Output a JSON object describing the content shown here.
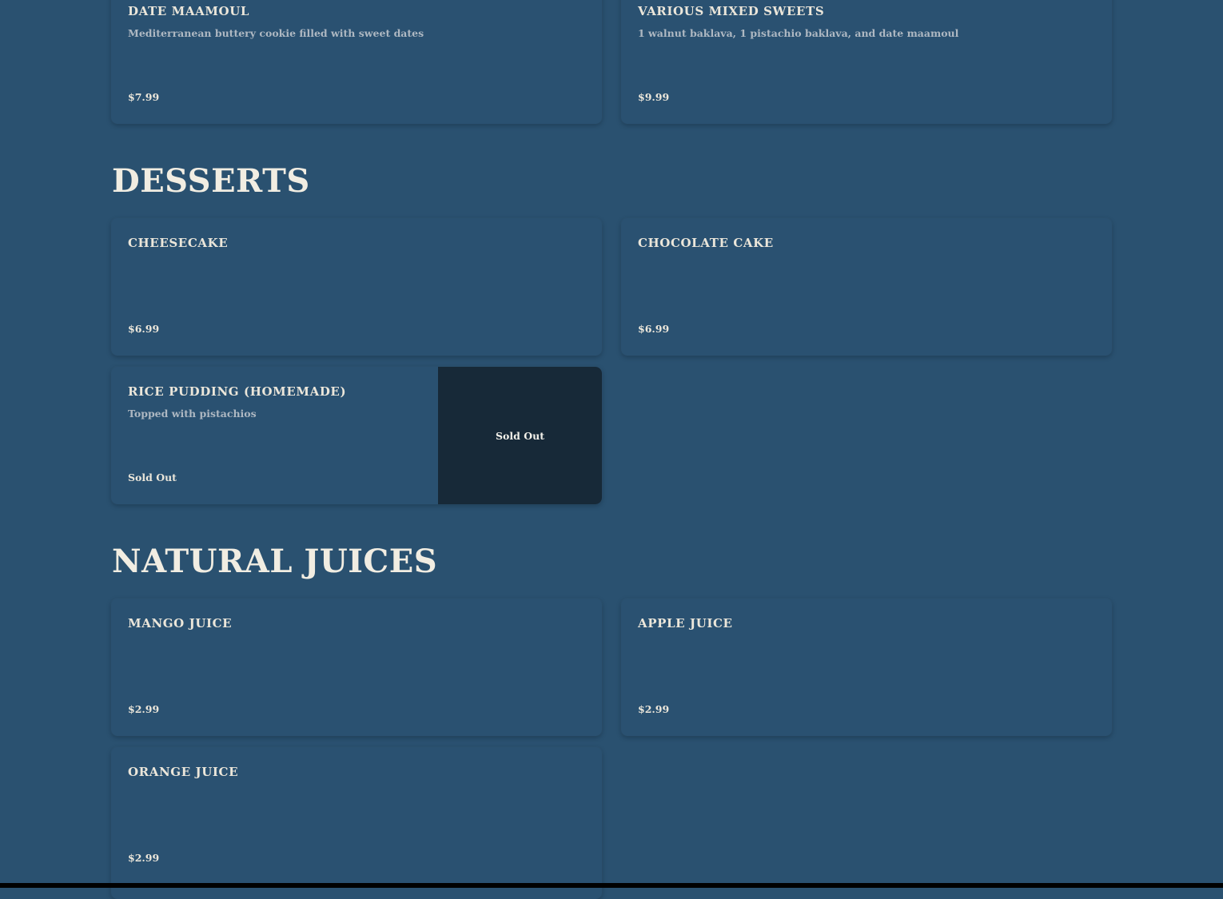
{
  "colors": {
    "page_background": "#2a5170",
    "card_background": "#2a5171",
    "sold_out_panel": "#172938",
    "heading_text": "#f1ede2",
    "description_text": "#aeb8c2"
  },
  "sections": [
    {
      "title": "",
      "items": [
        {
          "name": "Date Maamoul",
          "description": "Mediterranean buttery cookie filled with sweet dates",
          "price": "$7.99"
        },
        {
          "name": "Various Mixed Sweets",
          "description": "1 walnut baklava, 1 pistachio baklava, and date maamoul",
          "price": "$9.99"
        }
      ]
    },
    {
      "title": "DESSERTS",
      "items": [
        {
          "name": "Cheesecake",
          "description": "",
          "price": "$6.99"
        },
        {
          "name": "Chocolate Cake",
          "description": "",
          "price": "$6.99"
        },
        {
          "name": "Rice Pudding (Homemade)",
          "description": "Topped with pistachios",
          "price": "Sold Out",
          "image_overlay": "Sold Out"
        }
      ]
    },
    {
      "title": "NATURAL JUICES",
      "items": [
        {
          "name": "Mango Juice",
          "description": "",
          "price": "$2.99"
        },
        {
          "name": "Apple Juice",
          "description": "",
          "price": "$2.99"
        },
        {
          "name": "Orange Juice",
          "description": "",
          "price": "$2.99"
        }
      ]
    }
  ]
}
